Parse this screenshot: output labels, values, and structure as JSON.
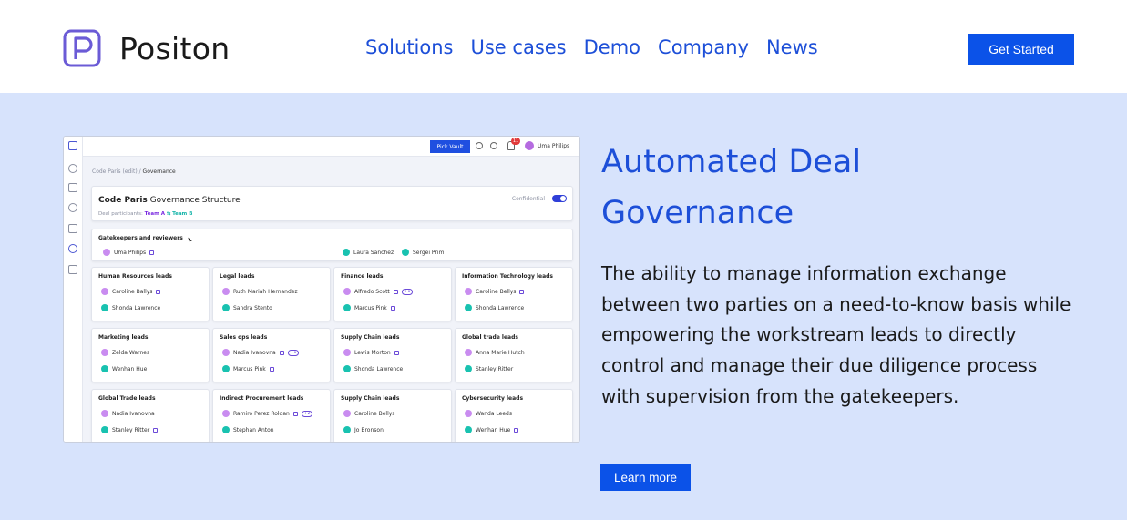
{
  "brand": {
    "name": "Positon",
    "logo_icon": "positon-logo-icon"
  },
  "nav": {
    "items": [
      "Solutions",
      "Use cases",
      "Demo",
      "Company",
      "News"
    ]
  },
  "header_cta": "Get Started",
  "colors": {
    "accent": "#0b52e8",
    "link": "#1d4fd8",
    "hero_bg": "#d7e3fc"
  },
  "hero": {
    "title_line1": "Automated Deal",
    "title_line2": "Governance",
    "body": "The ability to manage information exchange between two parties on a need-to-know basis while empowering the workstream leads to directly control and manage their due diligence process with supervision from the gatekeepers.",
    "button": "Learn more"
  },
  "app": {
    "pick_vault": "Pick Vault",
    "notifications": "11",
    "user": "Uma Philips",
    "breadcrumb_parent": "Code Paris (edit)",
    "breadcrumb_sep": "/",
    "breadcrumb_current": "Governance",
    "structure_title_bold": "Code Paris",
    "structure_title_rest": "Governance Structure",
    "participants_label": "Deal participants:",
    "team_a": "Team A",
    "team_arrow": "⇆",
    "team_b": "Team B",
    "confidential": "Confidential",
    "gatekeepers_title": "Gatekeepers and reviewers",
    "gatekeepers": [
      "Uma Philips",
      "Laura Sanchez",
      "Sergei Prim"
    ],
    "groups": [
      {
        "title": "Human Resources leads",
        "people": [
          "Caroline Ballys",
          "Shonda Lawrence"
        ]
      },
      {
        "title": "Legal leads",
        "people": [
          "Ruth Mariah Hernandez",
          "Sandra Stento"
        ]
      },
      {
        "title": "Finance leads",
        "people": [
          "Alfredo Scott",
          "Marcus Pink"
        ],
        "badge": "+1"
      },
      {
        "title": "Information Technology leads",
        "people": [
          "Caroline Bellys",
          "Shonda Lawrence"
        ]
      },
      {
        "title": "Marketing leads",
        "people": [
          "Zelda Warnes",
          "Wenhan Hue"
        ]
      },
      {
        "title": "Sales ops leads",
        "people": [
          "Nadia Ivanovna",
          "Marcus Pink"
        ],
        "badge": "+1"
      },
      {
        "title": "Supply Chain leads",
        "people": [
          "Lewis Morton",
          "Shonda Lawrence"
        ]
      },
      {
        "title": "Global trade leads",
        "people": [
          "Anna Marie Hutch",
          "Stanley Ritter"
        ]
      },
      {
        "title": "Global Trade leads",
        "people": [
          "Nadia Ivanovna",
          "Stanley Ritter"
        ]
      },
      {
        "title": "Indirect Procurement leads",
        "people": [
          "Ramiro Perez Roldan",
          "Stephan Anton"
        ],
        "badge": "+2"
      },
      {
        "title": "Supply Chain leads",
        "people": [
          "Caroline Bellys",
          "Jo Bronson"
        ]
      },
      {
        "title": "Cybersecurity leads",
        "people": [
          "Wanda Leeds",
          "Wenhan Hue"
        ]
      }
    ]
  }
}
